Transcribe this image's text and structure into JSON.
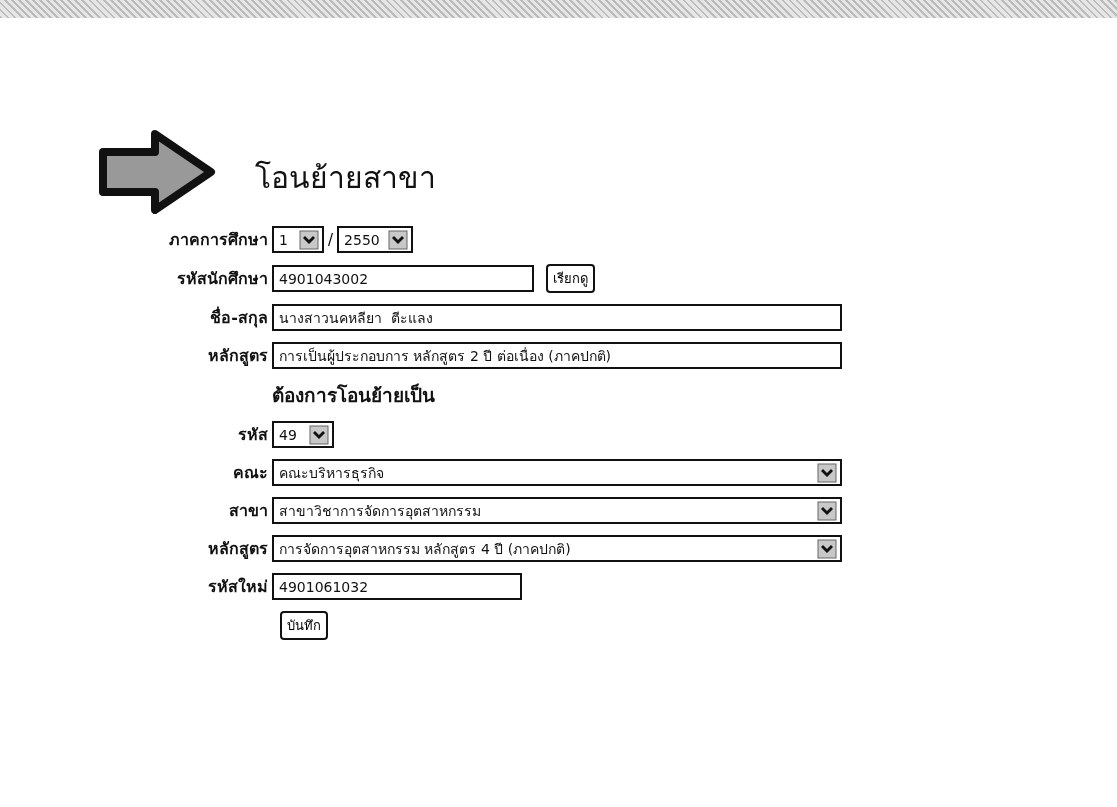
{
  "title": "โอนย้ายสาขา",
  "rows": [
    {
      "kind": "field",
      "label": "ภาคการศึกษา",
      "controls": [
        {
          "kind": "select",
          "value": "1"
        },
        {
          "kind": "separator",
          "value": "/"
        },
        {
          "kind": "select",
          "value": "2550"
        }
      ]
    },
    {
      "kind": "field",
      "label": "รหัสนักศึกษา",
      "controls": [
        {
          "kind": "text",
          "value": "4901043002"
        },
        {
          "kind": "button",
          "value": "เรียกดู"
        }
      ]
    },
    {
      "kind": "field",
      "label": "ชื่อ-สกุล",
      "controls": [
        {
          "kind": "text",
          "value": "นางสาวนคหลียา  ตีะแลง"
        }
      ]
    },
    {
      "kind": "field",
      "label": "หลักสูตร",
      "controls": [
        {
          "kind": "text",
          "value": "การเป็นผู้ประกอบการ หลักสูตร 2 ปี ต่อเนื่อง (ภาคปกติ)"
        }
      ]
    },
    {
      "kind": "heading",
      "label": "ต้องการโอนย้ายเป็น"
    },
    {
      "kind": "field",
      "label": "รหัส",
      "controls": [
        {
          "kind": "select",
          "value": "49"
        }
      ]
    },
    {
      "kind": "field",
      "label": "คณะ",
      "controls": [
        {
          "kind": "select",
          "value": "คณะบริหารธุรกิจ"
        }
      ]
    },
    {
      "kind": "field",
      "label": "สาขา",
      "controls": [
        {
          "kind": "select",
          "value": "สาขาวิชาการจัดการอุตสาหกรรม"
        }
      ]
    },
    {
      "kind": "field",
      "label": "หลักสูตร",
      "controls": [
        {
          "kind": "select",
          "value": "การจัดการอุตสาหกรรม หลักสูตร 4 ปี (ภาคปกติ)"
        }
      ]
    },
    {
      "kind": "field",
      "label": "รหัสใหม่",
      "controls": [
        {
          "kind": "text",
          "value": "4901061032"
        }
      ]
    },
    {
      "kind": "field",
      "controls": [
        {
          "kind": "button",
          "value": "บันทึก"
        }
      ]
    }
  ]
}
